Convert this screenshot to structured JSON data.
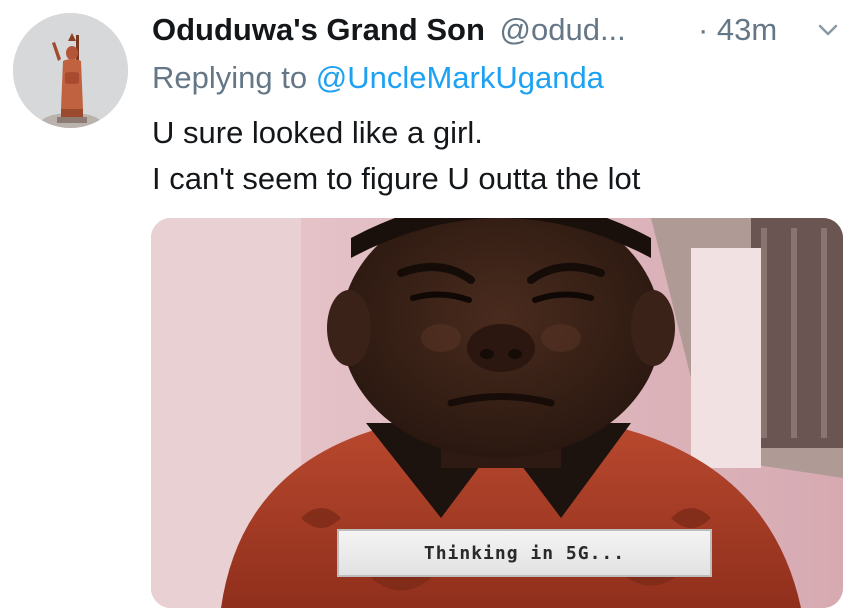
{
  "author": {
    "display_name": "Oduduwa's Grand Son",
    "handle": "@odud...",
    "timestamp": "· 43m"
  },
  "reply": {
    "prefix": "Replying to",
    "user": "@UncleMarkUganda"
  },
  "tweet": {
    "lines": [
      "U sure looked like a girl.",
      "I can't seem to figure U outta the lot"
    ]
  },
  "media": {
    "caption": "Thinking in 5G..."
  },
  "colors": {
    "text": "#14171a",
    "secondary": "#657786",
    "link": "#1da1f2"
  },
  "icons": {
    "menu": "chevron-down-icon"
  }
}
